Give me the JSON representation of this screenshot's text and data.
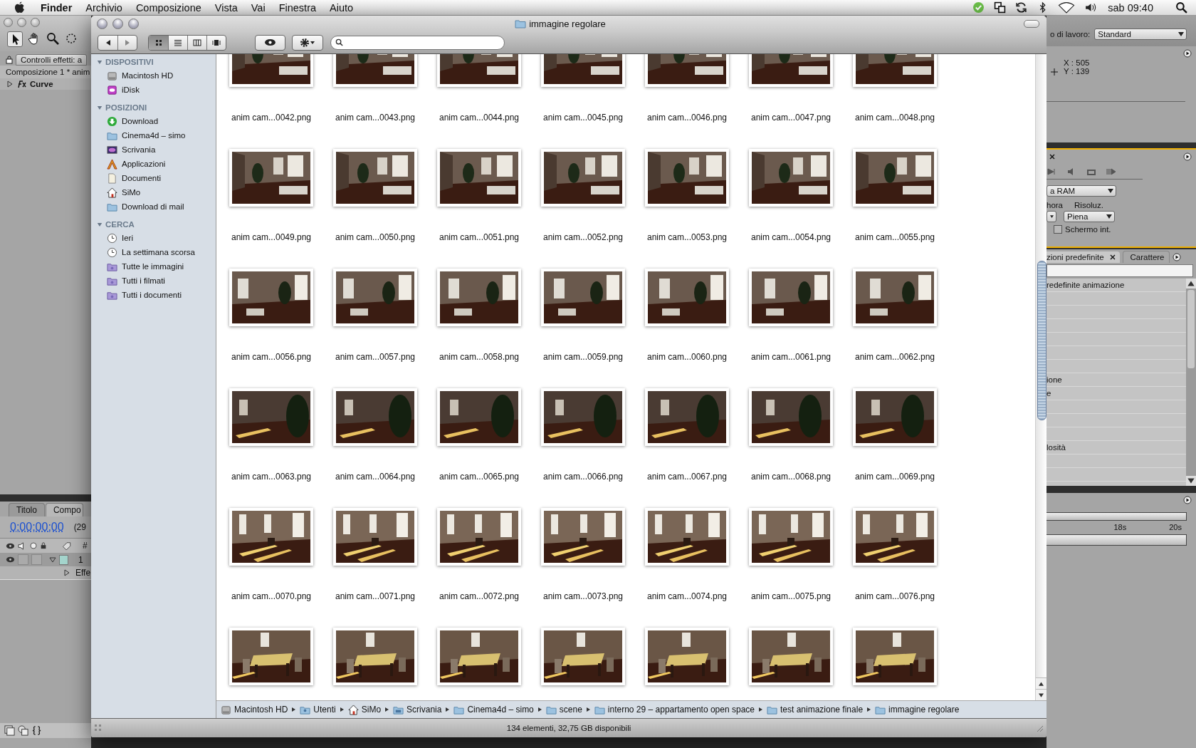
{
  "menu_bar": {
    "menus": [
      {
        "label": "Finder",
        "kind": "app"
      },
      {
        "label": "Archivio",
        "kind": "menu"
      },
      {
        "label": "Composizione",
        "kind": "menu"
      },
      {
        "label": "Vista",
        "kind": "menu"
      },
      {
        "label": "Vai",
        "kind": "menu"
      },
      {
        "label": "Finestra",
        "kind": "menu"
      },
      {
        "label": "Aiuto",
        "kind": "menu"
      }
    ],
    "clock": "sab 09:40"
  },
  "background_app": {
    "left_panel": {
      "effects_tab": "Controlli effetti: a",
      "composition": "Composizione 1 * anim",
      "effect": "Curve",
      "timeline_tabs": [
        {
          "label": "Titolo",
          "selected": false
        },
        {
          "label": "Compo",
          "selected": true
        }
      ],
      "timecode": "0;00;00;00",
      "frame_rate": "(29",
      "number_column": "#",
      "layer_number": "1",
      "layer_switches": [
        {
          "on": false
        },
        {
          "on": false
        }
      ],
      "effects_row": "Effe"
    },
    "right_panel": {
      "workspace_label": "o di lavoro:",
      "workspace": "Standard",
      "info": [
        "X : 505",
        "Y : 139"
      ],
      "ram_preview": "a RAM",
      "frame_label": "hora",
      "resolution_label": "Risoluz.",
      "resolution": "Piena",
      "fullscreen": {
        "label": "Schermo int.",
        "checked": false
      },
      "preset_tabs": [
        {
          "label": "zioni predefinite",
          "selected": true
        },
        {
          "label": "Carattere",
          "selected": false
        }
      ],
      "preset_rows": [
        {
          "label": "redefinite animazione"
        },
        {},
        {},
        {},
        {},
        {},
        {},
        {
          "label": "ione"
        },
        {
          "label": "e"
        },
        {},
        {},
        {},
        {
          "label": "losità"
        },
        {},
        {}
      ],
      "ruler": [
        "18s",
        "20s"
      ]
    }
  },
  "finder": {
    "title": "immagine regolare",
    "view_modes": [
      {
        "kind": "icon",
        "selected": true
      },
      {
        "kind": "list",
        "selected": false
      },
      {
        "kind": "column",
        "selected": false
      },
      {
        "kind": "coverflow",
        "selected": false
      }
    ],
    "sidebar": [
      {
        "heading": "DISPOSITIVI",
        "expanded": true,
        "items": [
          {
            "label": "Macintosh HD",
            "kind": "disk"
          },
          {
            "label": "iDisk",
            "kind": "idisk"
          }
        ]
      },
      {
        "heading": "POSIZIONI",
        "expanded": true,
        "items": [
          {
            "label": "Download",
            "kind": "download"
          },
          {
            "label": "Cinema4d – simo",
            "kind": "folder"
          },
          {
            "label": "Scrivania",
            "kind": "desktop"
          },
          {
            "label": "Applicazioni",
            "kind": "apps"
          },
          {
            "label": "Documenti",
            "kind": "document"
          },
          {
            "label": "SiMo",
            "kind": "home"
          },
          {
            "label": "Download di mail",
            "kind": "folder"
          }
        ]
      },
      {
        "heading": "CERCA",
        "expanded": true,
        "items": [
          {
            "label": "Ieri",
            "kind": "clock"
          },
          {
            "label": "La settimana scorsa",
            "kind": "clock"
          },
          {
            "label": "Tutte le immagini",
            "kind": "smart"
          },
          {
            "label": "Tutti i filmati",
            "kind": "smart"
          },
          {
            "label": "Tutti i documenti",
            "kind": "smart"
          }
        ]
      }
    ],
    "files": [
      {
        "name": "anim cam...0042.png"
      },
      {
        "name": "anim cam...0043.png"
      },
      {
        "name": "anim cam...0044.png"
      },
      {
        "name": "anim cam...0045.png"
      },
      {
        "name": "anim cam...0046.png"
      },
      {
        "name": "anim cam...0047.png"
      },
      {
        "name": "anim cam...0048.png"
      },
      {
        "name": "anim cam...0049.png"
      },
      {
        "name": "anim cam...0050.png"
      },
      {
        "name": "anim cam...0051.png"
      },
      {
        "name": "anim cam...0052.png"
      },
      {
        "name": "anim cam...0053.png"
      },
      {
        "name": "anim cam...0054.png"
      },
      {
        "name": "anim cam...0055.png"
      },
      {
        "name": "anim cam...0056.png"
      },
      {
        "name": "anim cam...0057.png"
      },
      {
        "name": "anim cam...0058.png"
      },
      {
        "name": "anim cam...0059.png"
      },
      {
        "name": "anim cam...0060.png"
      },
      {
        "name": "anim cam...0061.png"
      },
      {
        "name": "anim cam...0062.png"
      },
      {
        "name": "anim cam...0063.png"
      },
      {
        "name": "anim cam...0064.png"
      },
      {
        "name": "anim cam...0065.png"
      },
      {
        "name": "anim cam...0066.png"
      },
      {
        "name": "anim cam...0067.png"
      },
      {
        "name": "anim cam...0068.png"
      },
      {
        "name": "anim cam...0069.png"
      },
      {
        "name": "anim cam...0070.png"
      },
      {
        "name": "anim cam...0071.png"
      },
      {
        "name": "anim cam...0072.png"
      },
      {
        "name": "anim cam...0073.png"
      },
      {
        "name": "anim cam...0074.png"
      },
      {
        "name": "anim cam...0075.png"
      },
      {
        "name": "anim cam...0076.png"
      },
      {
        "kind": "picture"
      },
      {
        "kind": "picture"
      },
      {
        "kind": "picture"
      },
      {
        "kind": "picture"
      },
      {
        "kind": "picture"
      },
      {
        "kind": "picture"
      },
      {
        "kind": "picture"
      }
    ],
    "path_bar": [
      {
        "label": "Macintosh HD",
        "kind": "disk"
      },
      {
        "label": "Utenti",
        "kind": "users"
      },
      {
        "label": "SiMo",
        "kind": "home"
      },
      {
        "label": "Scrivania",
        "kind": "desktopfolder"
      },
      {
        "label": "Cinema4d – simo",
        "kind": "folder"
      },
      {
        "label": "scene",
        "kind": "folder"
      },
      {
        "label": "interno 29 – appartamento open space",
        "kind": "folder"
      },
      {
        "label": "test animazione finale",
        "kind": "folder"
      },
      {
        "label": "immagine regolare",
        "kind": "folder"
      }
    ],
    "status_bar": "134 elementi, 32,75 GB disponibili"
  }
}
